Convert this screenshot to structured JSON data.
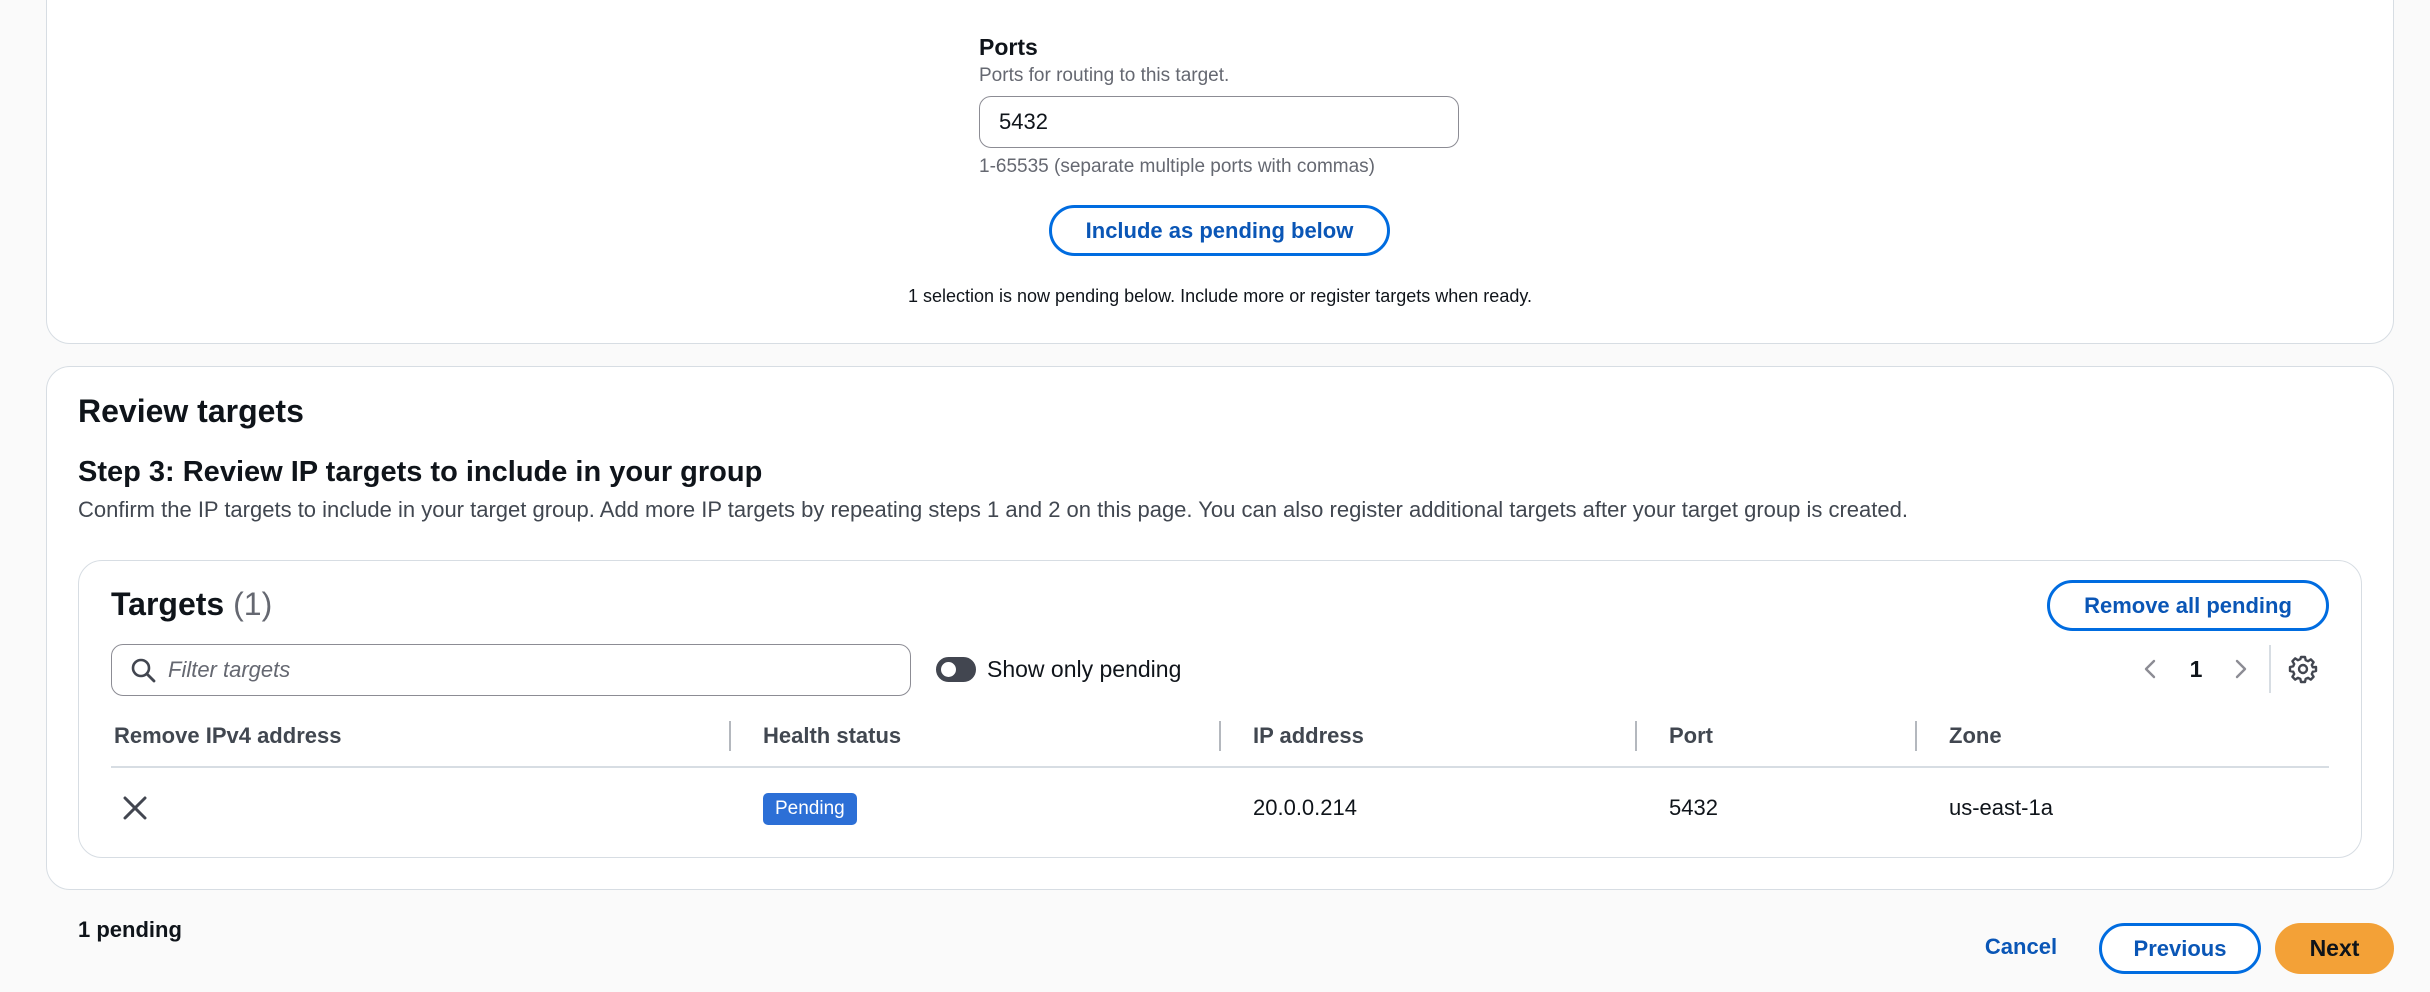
{
  "ports_section": {
    "label": "Ports",
    "description": "Ports for routing to this target.",
    "value": "5432",
    "hint": "1-65535 (separate multiple ports with commas)",
    "include_button": "Include as pending below",
    "pending_message": "1 selection is now pending below. Include more or register targets when ready."
  },
  "review": {
    "title": "Review targets",
    "step_title": "Step 3: Review IP targets to include in your group",
    "step_description": "Confirm the IP targets to include in your target group. Add more IP targets by repeating steps 1 and 2 on this page. You can also register additional targets after your target group is created."
  },
  "targets": {
    "title": "Targets",
    "count": "(1)",
    "remove_all_button": "Remove all pending",
    "filter_placeholder": "Filter targets",
    "toggle_label": "Show only pending",
    "toggle_on": false,
    "page_number": "1",
    "columns": [
      "Remove IPv4 address",
      "Health status",
      "IP address",
      "Port",
      "Zone"
    ],
    "rows": [
      {
        "health_status": "Pending",
        "ip_address": "20.0.0.214",
        "port": "5432",
        "zone": "us-east-1a"
      }
    ]
  },
  "footer": {
    "pending_count": "1 pending",
    "cancel": "Cancel",
    "previous": "Previous",
    "next": "Next"
  },
  "colors": {
    "primary_link": "#0a56b6",
    "primary_border": "#006ce0",
    "next_button": "#f3a137",
    "pending_badge": "#2c6fd6"
  },
  "icons": [
    "search-icon",
    "toggle-switch",
    "chevron-left-icon",
    "chevron-right-icon",
    "gear-icon",
    "close-icon"
  ]
}
